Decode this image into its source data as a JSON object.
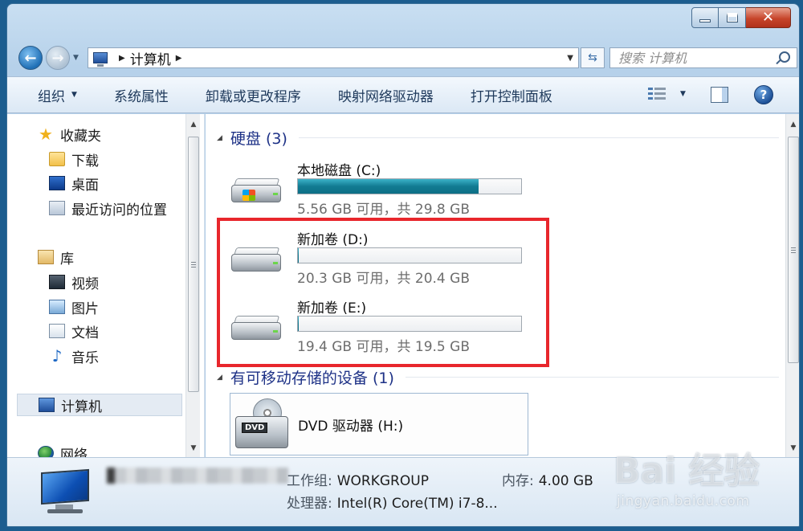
{
  "window": {
    "controls": {
      "minimize": "minimize",
      "maximize": "maximize",
      "close": "✕"
    }
  },
  "address_bar": {
    "path": [
      "计算机"
    ],
    "search_placeholder": "搜索 计算机"
  },
  "toolbar": {
    "items": [
      {
        "label": "组织",
        "has_dropdown": true
      },
      {
        "label": "系统属性"
      },
      {
        "label": "卸载或更改程序"
      },
      {
        "label": "映射网络驱动器"
      },
      {
        "label": "打开控制面板"
      }
    ],
    "help_label": "?"
  },
  "sidebar": {
    "favorites": {
      "label": "收藏夹",
      "icon": "star-icon"
    },
    "favorite_items": [
      {
        "label": "下载",
        "icon": "download-folder-icon"
      },
      {
        "label": "桌面",
        "icon": "desktop-icon"
      },
      {
        "label": "最近访问的位置",
        "icon": "recent-places-icon"
      }
    ],
    "libraries": {
      "label": "库",
      "icon": "libraries-icon"
    },
    "library_items": [
      {
        "label": "视频",
        "icon": "videos-icon"
      },
      {
        "label": "图片",
        "icon": "pictures-icon"
      },
      {
        "label": "文档",
        "icon": "documents-icon"
      },
      {
        "label": "音乐",
        "icon": "music-icon"
      }
    ],
    "computer": {
      "label": "计算机",
      "icon": "computer-icon",
      "selected": true
    },
    "network": {
      "label": "网络",
      "icon": "network-icon"
    }
  },
  "content": {
    "hard_disks_header": "硬盘 (3)",
    "drives": [
      {
        "name": "本地磁盘 (C:)",
        "space": "5.56 GB 可用，共 29.8 GB",
        "used_fraction": 0.81,
        "system": true
      },
      {
        "name": "新加卷 (D:)",
        "space": "20.3 GB 可用，共 20.4 GB",
        "used_fraction": 0.005,
        "system": false
      },
      {
        "name": "新加卷 (E:)",
        "space": "19.4 GB 可用，共 19.5 GB",
        "used_fraction": 0.005,
        "system": false
      }
    ],
    "removable_header": "有可移动存储的设备 (1)",
    "removable": [
      {
        "name": "DVD 驱动器 (H:)",
        "badge": "DVD"
      }
    ],
    "highlight_color": "#e8262c"
  },
  "details": {
    "workgroup_key": "工作组:",
    "workgroup_val": "WORKGROUP",
    "memory_key": "内存:",
    "memory_val": "4.00 GB",
    "processor_key": "处理器:",
    "processor_val": "Intel(R) Core(TM) i7-8..."
  },
  "watermark": {
    "logo": "Bai 经验",
    "url": "jingyan.baidu.com"
  }
}
